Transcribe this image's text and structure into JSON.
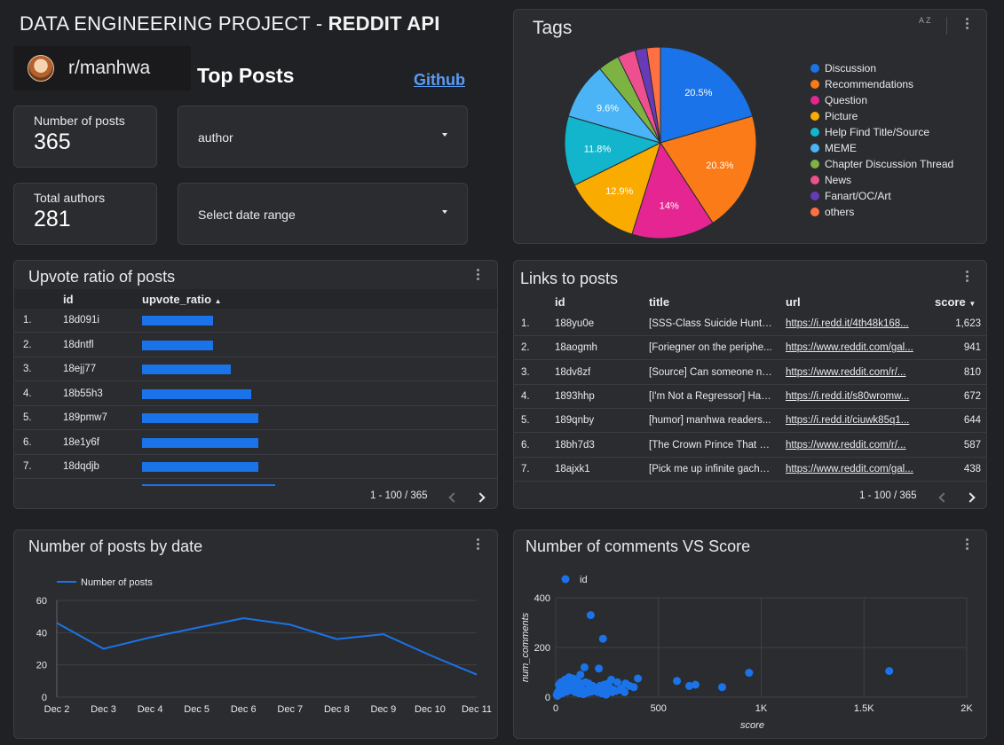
{
  "header": {
    "title_prefix": "DATA ENGINEERING PROJECT - ",
    "title_bold": "REDDIT API",
    "subreddit": "r/manhwa",
    "section_title": "Top Posts",
    "github_link": "Github"
  },
  "kpis": {
    "posts_label": "Number of posts",
    "posts_value": "365",
    "authors_label": "Total authors",
    "authors_value": "281"
  },
  "filters": {
    "author_label": "author",
    "date_label": "Select date range"
  },
  "colors": {
    "accent": "#1a73e8",
    "background": "#202124",
    "card": "#2b2c30"
  },
  "tags": {
    "title": "Tags",
    "sort_icon_label": "A Z",
    "legend": [
      {
        "name": "Discussion",
        "color": "#1a73e8"
      },
      {
        "name": "Recommendations",
        "color": "#fa7b17"
      },
      {
        "name": "Question",
        "color": "#e52592"
      },
      {
        "name": "Picture",
        "color": "#f9ab00"
      },
      {
        "name": "Help Find Title/Source",
        "color": "#12b5cb"
      },
      {
        "name": "MEME",
        "color": "#4ab4f6"
      },
      {
        "name": "Chapter Discussion Thread",
        "color": "#7cb342"
      },
      {
        "name": "News",
        "color": "#ee4f8f"
      },
      {
        "name": "Fanart/OC/Art",
        "color": "#673ab7"
      },
      {
        "name": "others",
        "color": "#ff7043"
      }
    ]
  },
  "upvote": {
    "title": "Upvote ratio of posts",
    "col_id": "id",
    "col_ratio": "upvote_ratio",
    "sort_indicator": "▲",
    "rows": [
      {
        "n": "1.",
        "id": "18d091i",
        "ratio": 0.8
      },
      {
        "n": "2.",
        "id": "18dntfl",
        "ratio": 0.8
      },
      {
        "n": "3.",
        "id": "18ejj77",
        "ratio": 1.0
      },
      {
        "n": "4.",
        "id": "18b55h3",
        "ratio": 1.23
      },
      {
        "n": "5.",
        "id": "189pmw7",
        "ratio": 1.31
      },
      {
        "n": "6.",
        "id": "18e1y6f",
        "ratio": 1.31
      },
      {
        "n": "7.",
        "id": "18dqdjb",
        "ratio": 1.31
      }
    ],
    "pager": "1 - 100 / 365"
  },
  "links": {
    "title": "Links to posts",
    "col_id": "id",
    "col_title": "title",
    "col_url": "url",
    "col_score": "score",
    "sort_indicator": "▼",
    "rows": [
      {
        "n": "1.",
        "id": "188yu0e",
        "title": "[SSS-Class Suicide Hunter]...",
        "url": "https://i.redd.it/4th48k168...",
        "score": "1,623"
      },
      {
        "n": "2.",
        "id": "18aogmh",
        "title": "[Foriegner on the periphe...",
        "url": "https://www.reddit.com/gal...",
        "score": "941"
      },
      {
        "n": "3.",
        "id": "18dv8zf",
        "title": "[Source] Can someone na...",
        "url": "https://www.reddit.com/r/...",
        "score": "810"
      },
      {
        "n": "4.",
        "id": "1893hhp",
        "title": "[I'm Not a Regressor] Had...",
        "url": "https://i.redd.it/s80wromw...",
        "score": "672"
      },
      {
        "n": "5.",
        "id": "189qnby",
        "title": "[humor] manhwa readers...",
        "url": "https://i.redd.it/ciuwk85q1...",
        "score": "644"
      },
      {
        "n": "6.",
        "id": "18bh7d3",
        "title": "[The Crown Prince That Se...",
        "url": "https://www.reddit.com/r/...",
        "score": "587"
      },
      {
        "n": "7.",
        "id": "18ajxk1",
        "title": "[Pick me up infinite gacha...",
        "url": "https://www.reddit.com/gal...",
        "score": "438"
      }
    ],
    "pager": "1 - 100 / 365"
  },
  "chart_data": [
    {
      "type": "pie",
      "title": "Tags",
      "categories": [
        "Discussion",
        "Recommendations",
        "Question",
        "Picture",
        "Help Find Title/Source",
        "MEME",
        "Chapter Discussion Thread",
        "News",
        "Fanart/OC/Art",
        "others"
      ],
      "values": [
        20.5,
        20.3,
        14.0,
        12.9,
        11.8,
        9.6,
        3.6,
        3.0,
        2.0,
        2.3
      ],
      "labels": [
        "20.5%",
        "20.3%",
        "14%",
        "12.9%",
        "11.8%",
        "9.6%",
        "",
        "",
        "",
        ""
      ],
      "colors": [
        "#1a73e8",
        "#fa7b17",
        "#e52592",
        "#f9ab00",
        "#12b5cb",
        "#4ab4f6",
        "#7cb342",
        "#ee4f8f",
        "#673ab7",
        "#ff7043"
      ],
      "legend_position": "right"
    },
    {
      "type": "line",
      "title": "Number of posts by date",
      "x": [
        "Dec 2",
        "Dec 3",
        "Dec 4",
        "Dec 5",
        "Dec 6",
        "Dec 7",
        "Dec 8",
        "Dec 9",
        "Dec 10",
        "Dec 11"
      ],
      "series": [
        {
          "name": "Number of posts",
          "values": [
            46,
            30,
            37,
            43,
            49,
            45,
            36,
            39,
            26,
            14
          ]
        }
      ],
      "yticks": [
        0,
        20,
        40,
        60
      ],
      "ylim": [
        0,
        60
      ],
      "legend_position": "top-left",
      "grid": true
    },
    {
      "type": "scatter",
      "title": "Number of comments VS Score",
      "xlabel": "score",
      "ylabel": "num_comments",
      "series_name": "id",
      "xticks": [
        "0",
        "500",
        "1K",
        "1.5K",
        "2K"
      ],
      "xtick_values": [
        0,
        500,
        1000,
        1500,
        2000
      ],
      "yticks": [
        0,
        200,
        400
      ],
      "xlim": [
        0,
        2000
      ],
      "ylim": [
        0,
        400
      ],
      "points": [
        [
          170,
          330
        ],
        [
          230,
          235
        ],
        [
          140,
          120
        ],
        [
          210,
          115
        ],
        [
          1623,
          105
        ],
        [
          941,
          98
        ],
        [
          400,
          75
        ],
        [
          590,
          65
        ],
        [
          650,
          45
        ],
        [
          680,
          50
        ],
        [
          810,
          40
        ],
        [
          300,
          60
        ],
        [
          340,
          55
        ],
        [
          270,
          70
        ],
        [
          120,
          90
        ],
        [
          100,
          70
        ],
        [
          80,
          60
        ],
        [
          60,
          45
        ],
        [
          40,
          40
        ],
        [
          20,
          30
        ],
        [
          10,
          20
        ],
        [
          5,
          10
        ],
        [
          30,
          15
        ],
        [
          50,
          25
        ],
        [
          70,
          35
        ],
        [
          90,
          50
        ],
        [
          110,
          40
        ],
        [
          130,
          30
        ],
        [
          150,
          25
        ],
        [
          160,
          55
        ],
        [
          180,
          45
        ],
        [
          200,
          35
        ],
        [
          220,
          30
        ],
        [
          240,
          25
        ],
        [
          260,
          40
        ],
        [
          280,
          30
        ],
        [
          320,
          35
        ],
        [
          360,
          45
        ],
        [
          380,
          40
        ],
        [
          15,
          50
        ],
        [
          25,
          60
        ],
        [
          45,
          70
        ],
        [
          65,
          80
        ],
        [
          85,
          75
        ],
        [
          105,
          65
        ],
        [
          125,
          55
        ],
        [
          145,
          60
        ],
        [
          165,
          40
        ],
        [
          185,
          30
        ],
        [
          205,
          20
        ],
        [
          225,
          15
        ],
        [
          245,
          10
        ],
        [
          8,
          5
        ],
        [
          12,
          8
        ],
        [
          18,
          12
        ],
        [
          35,
          18
        ],
        [
          55,
          22
        ],
        [
          75,
          28
        ],
        [
          95,
          20
        ],
        [
          115,
          15
        ],
        [
          135,
          12
        ],
        [
          155,
          18
        ],
        [
          175,
          22
        ],
        [
          195,
          25
        ],
        [
          215,
          45
        ],
        [
          235,
          50
        ],
        [
          255,
          55
        ],
        [
          275,
          20
        ],
        [
          295,
          25
        ],
        [
          315,
          30
        ],
        [
          335,
          20
        ]
      ]
    }
  ]
}
